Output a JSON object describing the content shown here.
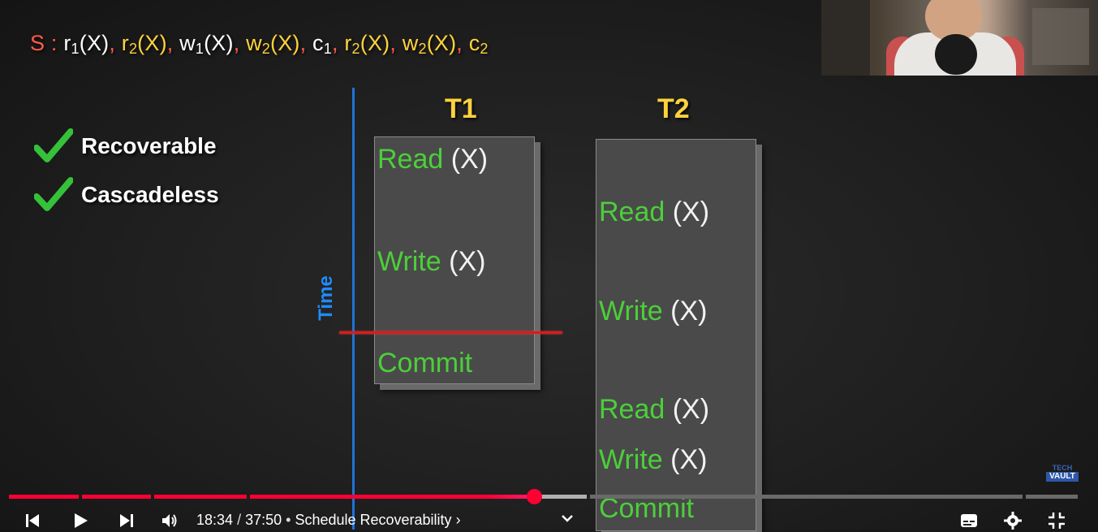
{
  "schedule": {
    "prefix": "S :",
    "ops": [
      {
        "name": "r",
        "sub": "1",
        "arg": "(X)",
        "color": "#ffffff"
      },
      {
        "name": "r",
        "sub": "2",
        "arg": "(X)",
        "color": "#ffd23c"
      },
      {
        "name": "w",
        "sub": "1",
        "arg": "(X)",
        "color": "#ffffff"
      },
      {
        "name": "w",
        "sub": "2",
        "arg": "(X)",
        "color": "#ffd23c"
      },
      {
        "name": "c",
        "sub": "1",
        "arg": "",
        "color": "#ffffff"
      },
      {
        "name": "r",
        "sub": "2",
        "arg": "(X)",
        "color": "#ffd23c"
      },
      {
        "name": "w",
        "sub": "2",
        "arg": "(X)",
        "color": "#ffd23c"
      },
      {
        "name": "c",
        "sub": "2",
        "arg": "",
        "color": "#ffd23c"
      }
    ]
  },
  "checks": [
    {
      "label": "Recoverable"
    },
    {
      "label": "Cascadeless"
    }
  ],
  "axis_label": "Time",
  "t1": {
    "title": "T1",
    "ops": [
      {
        "verb": "Read",
        "arg": "(X)"
      },
      {
        "verb": "Write",
        "arg": "(X)"
      },
      {
        "verb": "Commit",
        "arg": ""
      }
    ]
  },
  "t2": {
    "title": "T2",
    "ops": [
      {
        "verb": "Read",
        "arg": "(X)"
      },
      {
        "verb": "Write",
        "arg": "(X)"
      },
      {
        "verb": "Read",
        "arg": "(X)"
      },
      {
        "verb": "Write",
        "arg": "(X)"
      },
      {
        "verb": "Commit",
        "arg": ""
      }
    ]
  },
  "brand": {
    "line1": "TECH",
    "line2": "VAULT"
  },
  "player": {
    "current_time": "18:34",
    "duration": "37:50",
    "chapter": "Schedule Recoverability",
    "progress": 0.494,
    "icons": [
      "previous-icon",
      "play-icon",
      "next-icon",
      "volume-icon",
      "chevron-down-icon",
      "subtitles-icon",
      "settings-icon",
      "exit-fullscreen-icon"
    ]
  },
  "colors": {
    "accent_green": "#4ccf3a",
    "accent_yellow": "#ffd23c",
    "accent_red": "#ff5b4a",
    "axis_blue": "#1e73d6",
    "progress_red": "#ff0033"
  }
}
